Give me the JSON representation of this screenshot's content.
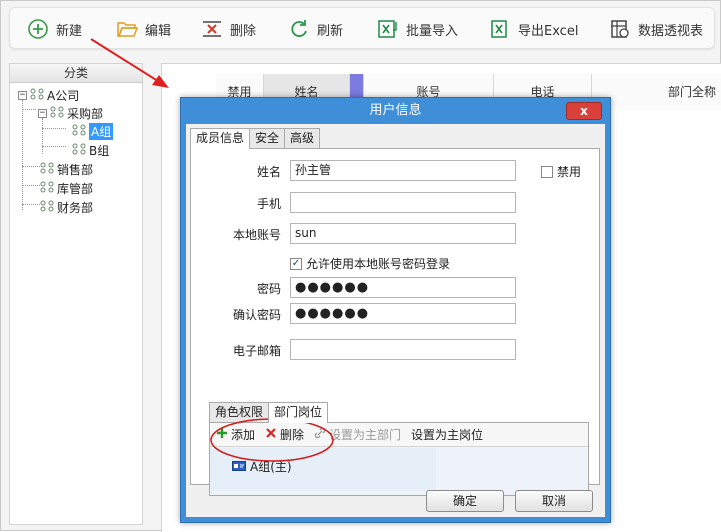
{
  "toolbar": {
    "items": [
      {
        "label": "新建",
        "icon": "plus-circle-icon"
      },
      {
        "label": "编辑",
        "icon": "folder-open-icon"
      },
      {
        "label": "删除",
        "icon": "delete-x-icon"
      },
      {
        "label": "刷新",
        "icon": "refresh-icon"
      },
      {
        "label": "批量导入",
        "icon": "excel-import-icon"
      },
      {
        "label": "导出Excel",
        "icon": "excel-export-icon"
      },
      {
        "label": "数据透视表",
        "icon": "pivot-table-icon"
      }
    ]
  },
  "tree": {
    "header": "分类",
    "nodes": [
      {
        "label": "A公司",
        "expander": "⊟"
      },
      {
        "label": "采购部",
        "expander": "⊟"
      },
      {
        "label": "A组",
        "selected": true
      },
      {
        "label": "B组"
      },
      {
        "label": "销售部"
      },
      {
        "label": "库管部"
      },
      {
        "label": "财务部"
      }
    ]
  },
  "grid": {
    "columns": [
      "禁用",
      "姓名",
      "账号",
      "电话",
      "部门全称"
    ]
  },
  "dialog": {
    "title": "用户信息",
    "close": "x",
    "tabs": [
      "成员信息",
      "安全",
      "高级"
    ],
    "fields": {
      "name_label": "姓名",
      "name_value": "孙主管",
      "disabled_label": "禁用",
      "mobile_label": "手机",
      "mobile_value": "",
      "local_account_label": "本地账号",
      "local_account_value": "sun",
      "allow_login_label": "允许使用本地账号密码登录",
      "password_label": "密码",
      "password_value": "●●●●●●",
      "confirm_password_label": "确认密码",
      "confirm_password_value": "●●●●●●",
      "email_label": "电子邮箱",
      "email_value": ""
    },
    "subtabs": [
      "角色权限",
      "部门岗位"
    ],
    "subtoolbar": {
      "add": "添加",
      "delete": "删除",
      "set_main_dept": "设置为主部门",
      "set_main_post": "设置为主岗位"
    },
    "dept_list": [
      "A组(主)"
    ],
    "buttons": {
      "ok": "确定",
      "cancel": "取消"
    }
  },
  "colors": {
    "dialog_border": "#3f8fd8",
    "close_button": "#d9403a",
    "annotation": "#e02020",
    "selection": "#3399ff"
  }
}
